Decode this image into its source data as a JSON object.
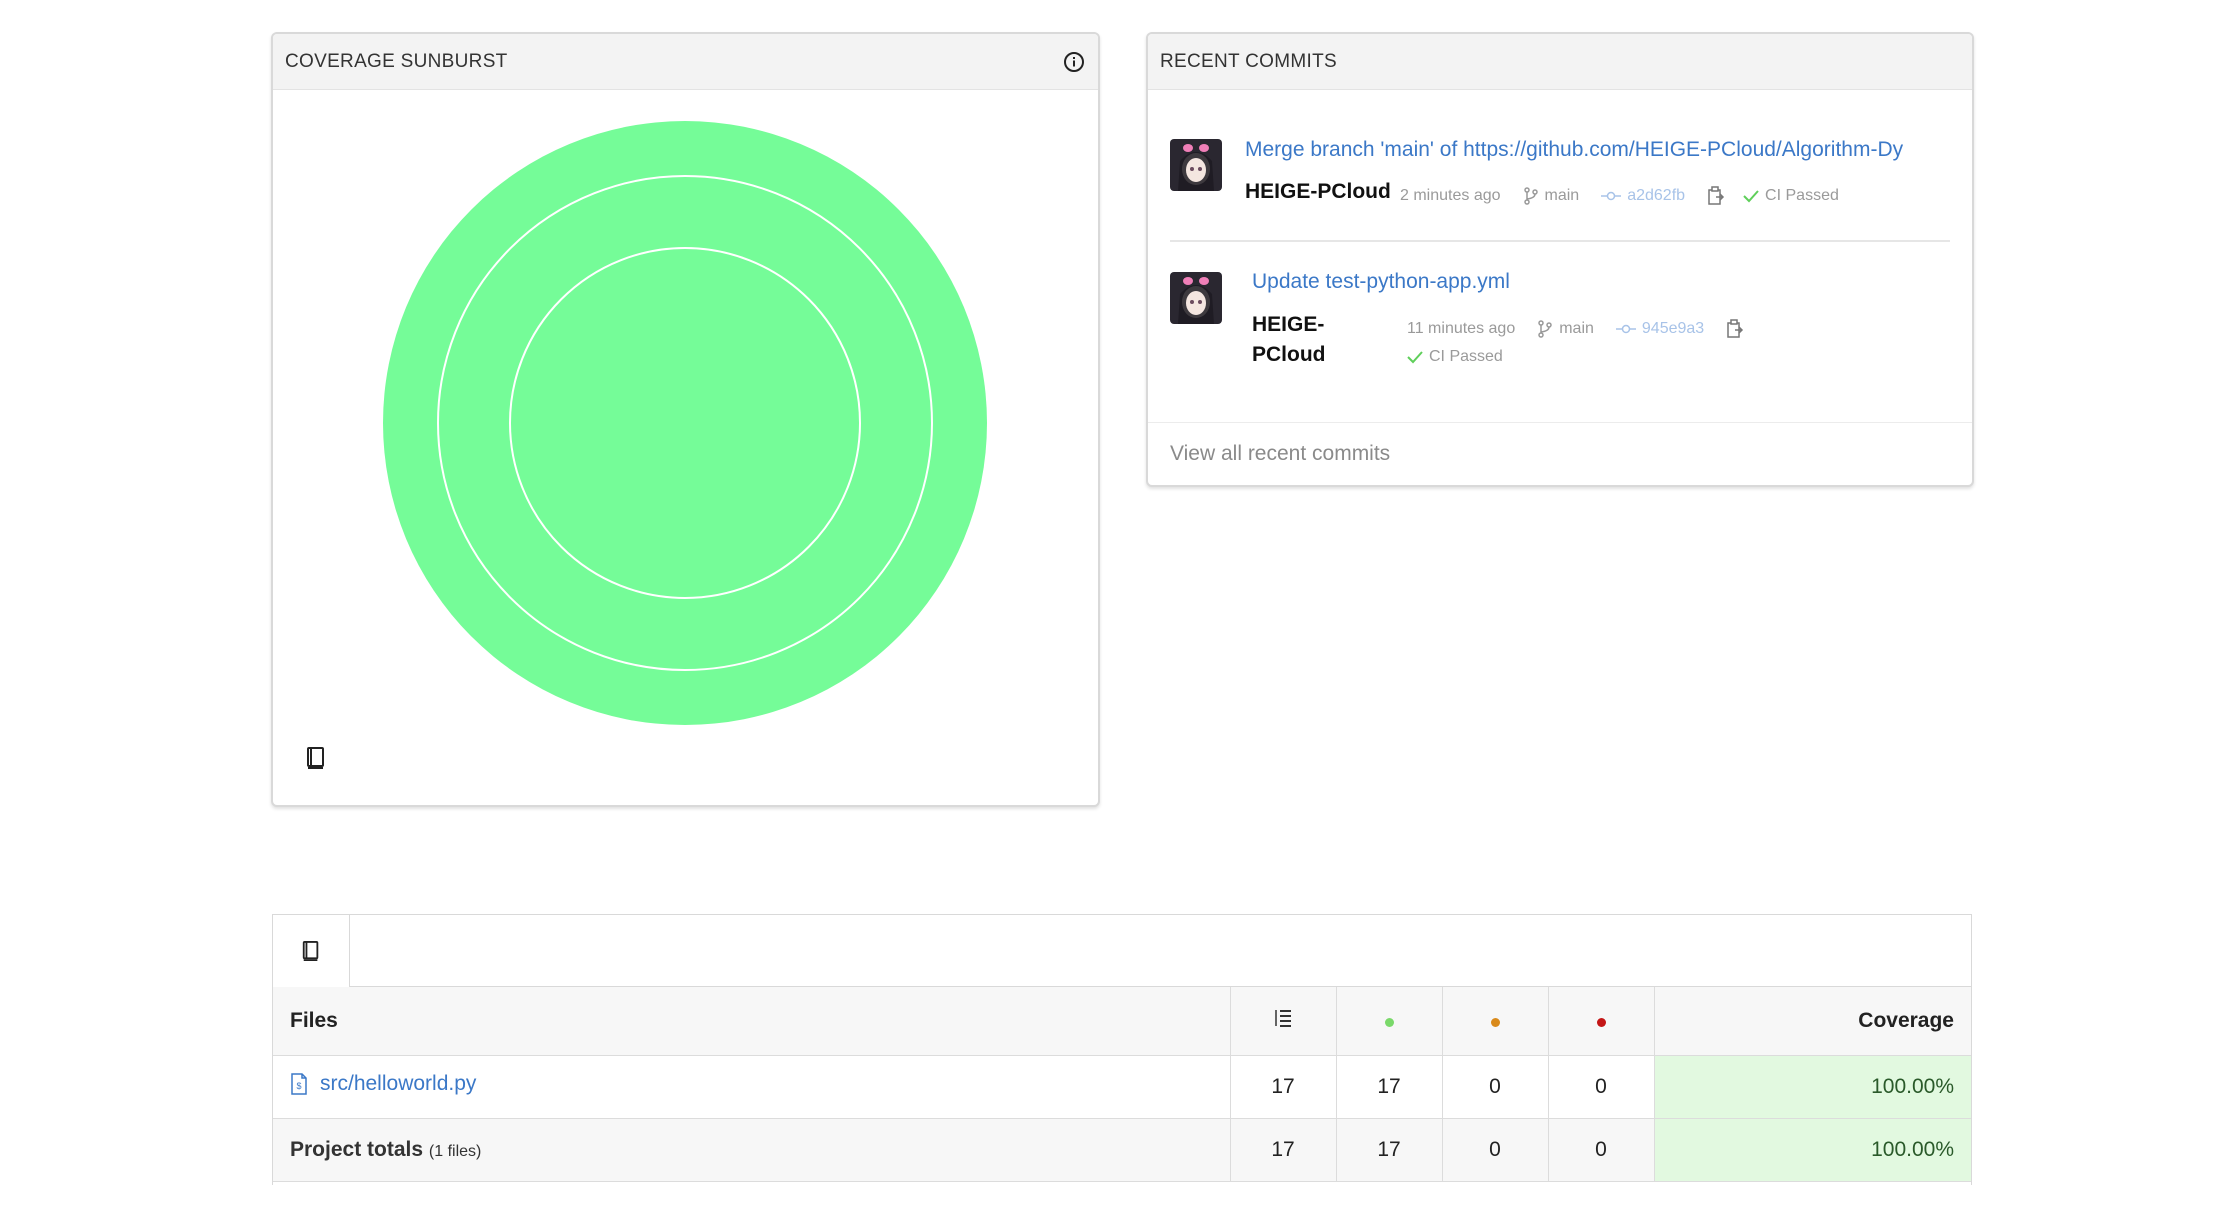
{
  "sunburst": {
    "title": "COVERAGE SUNBURST",
    "color": "#75fc98",
    "ring_stroke": "#ffffff",
    "icons": [
      "info-icon",
      "book-icon"
    ]
  },
  "commits": {
    "title": "RECENT COMMITS",
    "items": [
      {
        "message": "Merge branch 'main' of https://github.com/HEIGE-PCloud/Algorithm-Dy",
        "author": "HEIGE-PCloud",
        "time": "2 minutes ago",
        "branch": "main",
        "sha": "a2d62fb",
        "ci": "CI Passed"
      },
      {
        "message": "Update test-python-app.yml",
        "author_line1": "HEIGE-",
        "author_line2": "PCloud",
        "time": "11 minutes ago",
        "branch": "main",
        "sha": "945e9a3",
        "ci": "CI Passed"
      }
    ],
    "view_all": "View all recent commits"
  },
  "table": {
    "headers": {
      "files": "Files",
      "coverage": "Coverage"
    },
    "status_colors": {
      "hit": "#7ad96a",
      "partial": "#d98a1b",
      "miss": "#c41616"
    },
    "rows": [
      {
        "file": "src/helloworld.py",
        "lines": "17",
        "hit": "17",
        "partial": "0",
        "miss": "0",
        "coverage": "100.00%"
      }
    ],
    "totals": {
      "label": "Project totals",
      "files_note": "(1 files)",
      "lines": "17",
      "hit": "17",
      "partial": "0",
      "miss": "0",
      "coverage": "100.00%"
    }
  }
}
